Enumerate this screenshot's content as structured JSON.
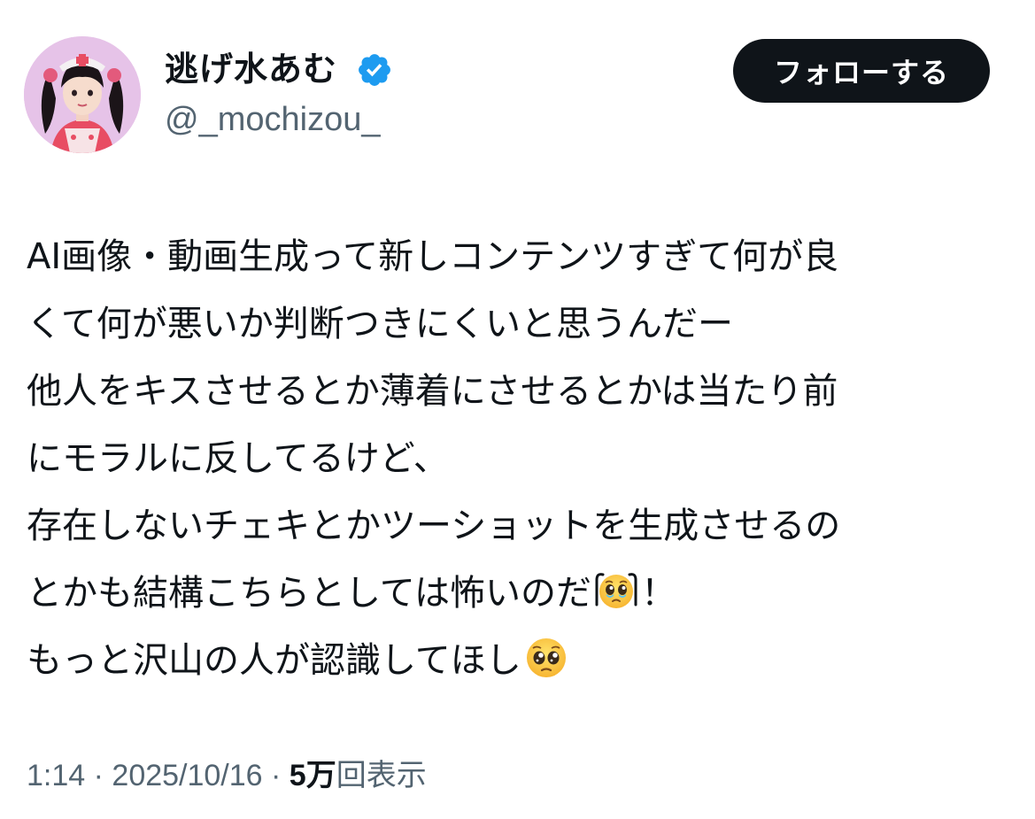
{
  "author": {
    "display_name": "逃げ水あむ",
    "handle": "@_mochizou_",
    "verified": true,
    "verified_badge_color": "#1d9bf0"
  },
  "follow_button": {
    "label": "フォローする"
  },
  "tweet": {
    "lines": [
      "AI画像・動画生成って新しコンテンツすぎて何が良",
      "くて何が悪いか判断つきにくいと思うんだー",
      "他人をキスさせるとか薄着にさせるとかは当たり前",
      "にモラルに反してるけど、",
      "存在しないチェキとかツーショットを生成させるの"
    ],
    "line6_text_a": "とかも結構こちらとしては怖いのだ",
    "line6_emoji": "holding-back-tears-emoji",
    "line6_text_b": "！",
    "line7_text": "もっと沢山の人が認識してほし",
    "line7_emoji": "pleading-face-emoji"
  },
  "meta": {
    "time": "1:14",
    "separator": " · ",
    "date": "2025/10/16",
    "views_number": "5万",
    "views_label": "回表示"
  },
  "colors": {
    "text_primary": "#0f1419",
    "text_secondary": "#536471",
    "button_bg": "#0f1419",
    "button_text": "#ffffff"
  }
}
